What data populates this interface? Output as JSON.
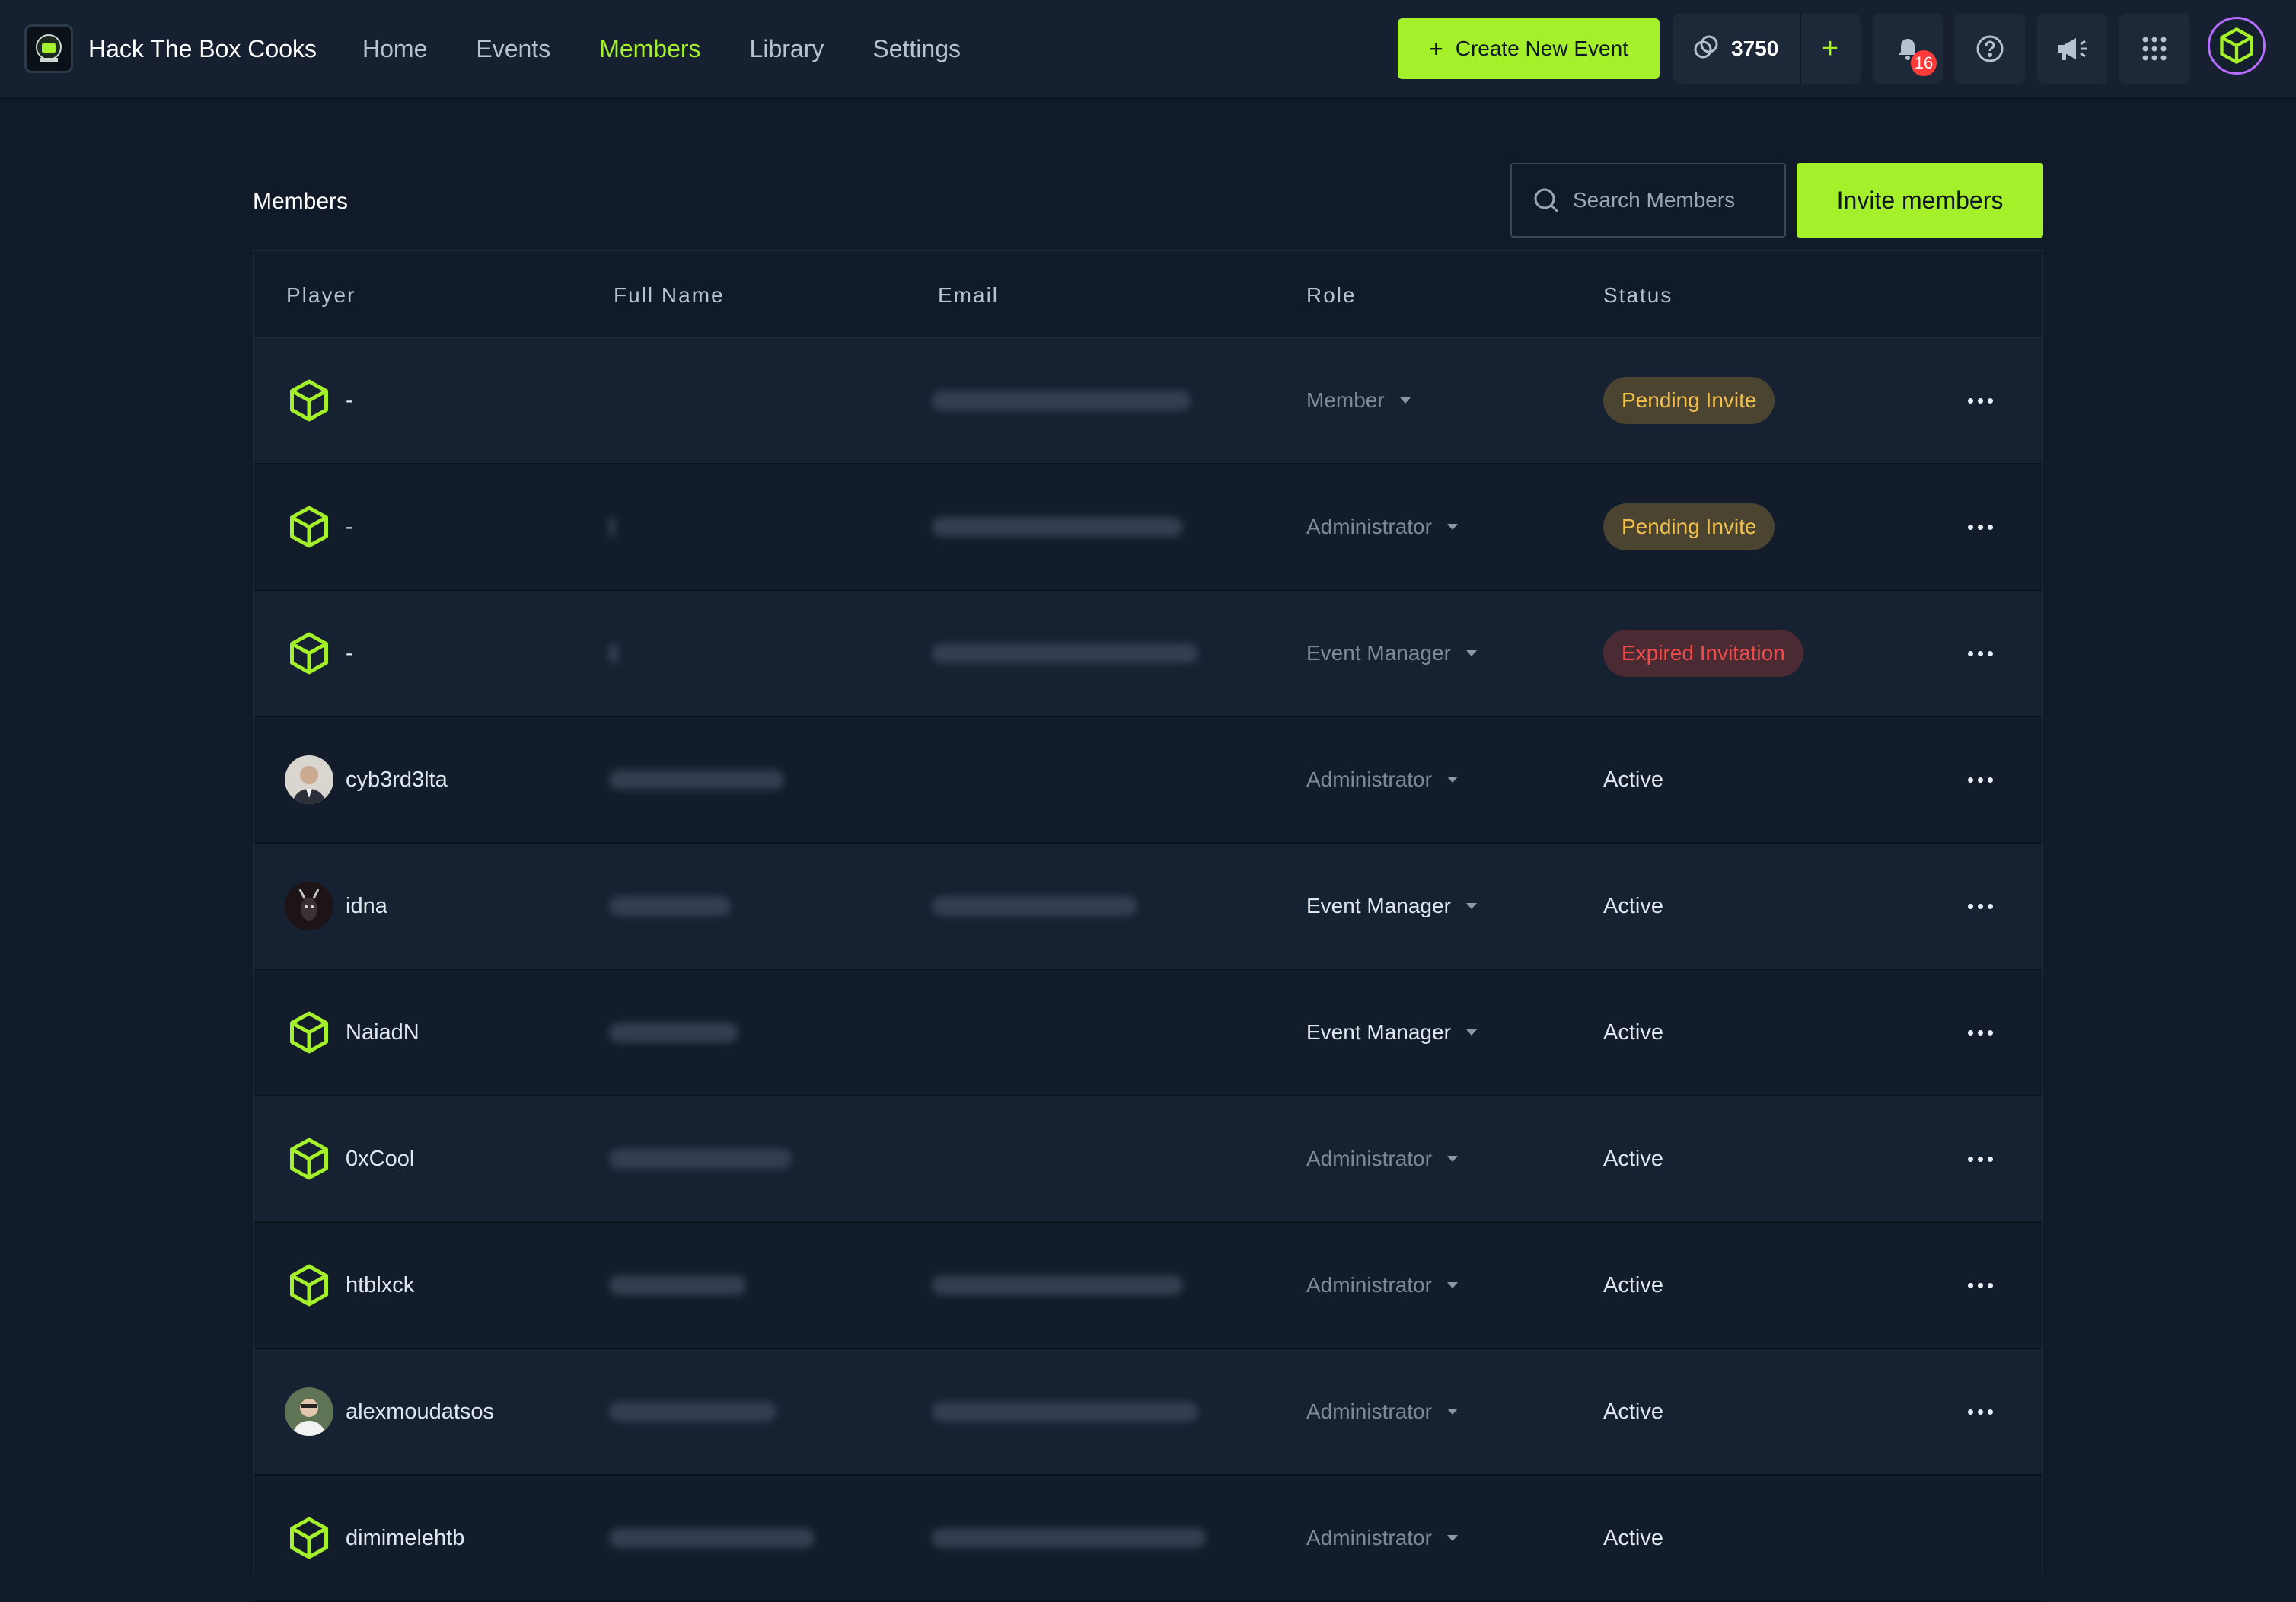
{
  "brand": {
    "title": "Hack The Box Cooks"
  },
  "nav": [
    {
      "label": "Home",
      "active": false
    },
    {
      "label": "Events",
      "active": false
    },
    {
      "label": "Members",
      "active": true
    },
    {
      "label": "Library",
      "active": false
    },
    {
      "label": "Settings",
      "active": false
    }
  ],
  "toolbar": {
    "create_label": "Create New Event",
    "credits": "3750",
    "notifications": "16"
  },
  "colors": {
    "accent": "#a4f02b",
    "background": "#111a28",
    "pending": "#f2c04e",
    "expired": "#ef4b4b"
  },
  "page": {
    "title": "Members",
    "search_placeholder": "Search Members",
    "invite_label": "Invite members"
  },
  "table": {
    "columns": [
      "Player",
      "Full Name",
      "Email",
      "Role",
      "Status"
    ],
    "rows": [
      {
        "player": "-",
        "avatar": "cube-icon",
        "role": "Member",
        "status": "Pending Invite"
      },
      {
        "player": "-",
        "avatar": "cube-icon",
        "role": "Administrator",
        "status": "Pending Invite"
      },
      {
        "player": "-",
        "avatar": "cube-icon",
        "role": "Event Manager",
        "status": "Expired Invitation"
      },
      {
        "player": "cyb3rd3lta",
        "avatar": "user-photo",
        "role": "Administrator",
        "status": "Active"
      },
      {
        "player": "idna",
        "avatar": "user-photo",
        "role": "Event Manager",
        "status": "Active"
      },
      {
        "player": "NaiadN",
        "avatar": "cube-icon",
        "role": "Event Manager",
        "status": "Active"
      },
      {
        "player": "0xCool",
        "avatar": "cube-icon",
        "role": "Administrator",
        "status": "Active"
      },
      {
        "player": "htblxck",
        "avatar": "cube-icon",
        "role": "Administrator",
        "status": "Active"
      },
      {
        "player": "alexmoudatsos",
        "avatar": "user-photo",
        "role": "Administrator",
        "status": "Active"
      },
      {
        "player": "dimimelehtb",
        "avatar": "cube-icon",
        "role": "Administrator",
        "status": "Active"
      }
    ]
  }
}
